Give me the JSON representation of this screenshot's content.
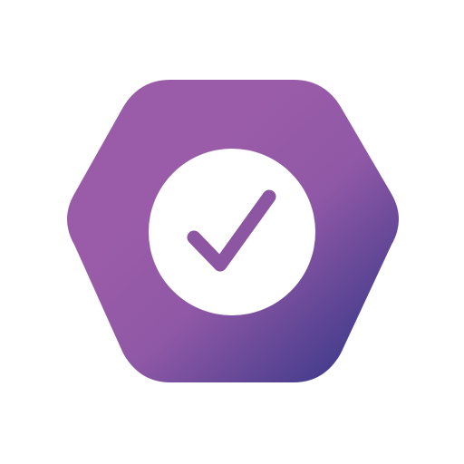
{
  "logo": {
    "icon": "check-badge-icon",
    "colors": {
      "gradient_start": "#9a5ca8",
      "gradient_mid": "#8f58a6",
      "gradient_end": "#4a3e8e",
      "circle": "#ffffff",
      "check": "#8c56a3",
      "background": "#ffffff"
    }
  }
}
